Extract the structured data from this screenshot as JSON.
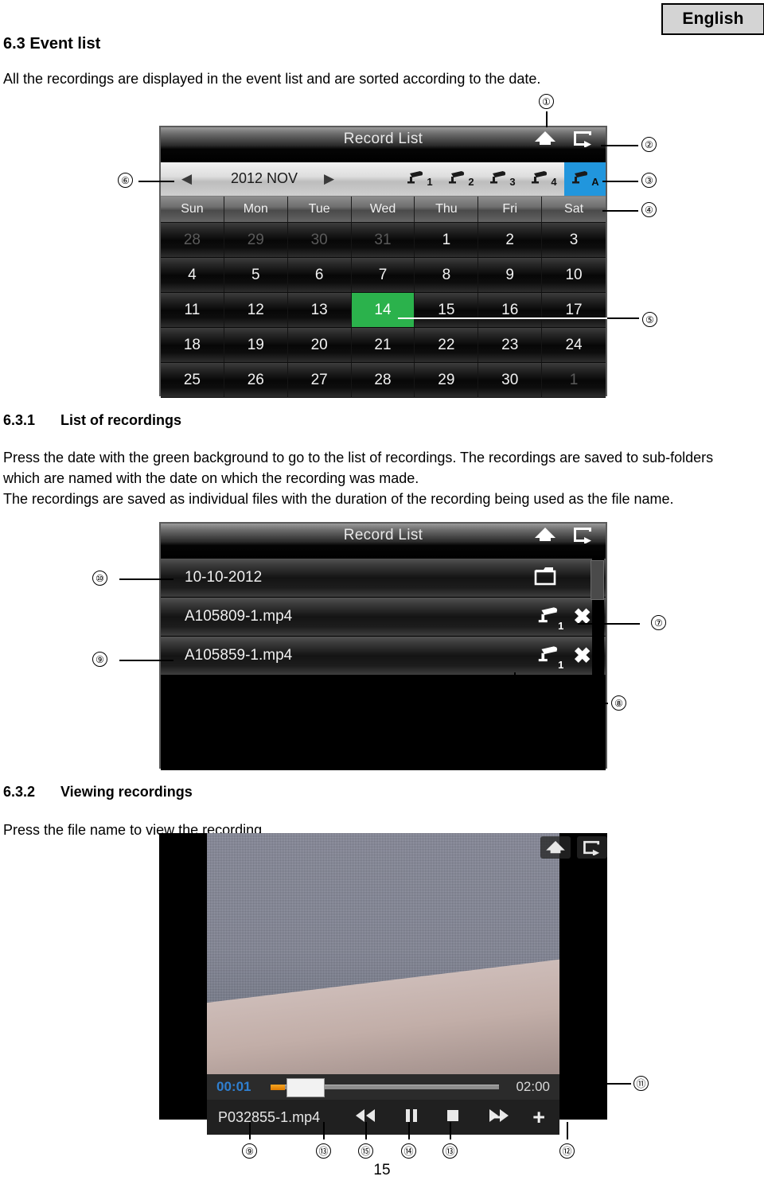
{
  "badge": {
    "language": "English"
  },
  "document": {
    "heading_1": "6.3 Event list",
    "intro": "All the recordings are displayed in the event list and are sorted according to the date.",
    "section_631_num": "6.3.1",
    "section_631_title": "List of recordings",
    "section_631_body": "Press the date with the green background to go to the list of recordings. The recordings are saved to sub-folders which are named with the date on which the recording was made.\nThe recordings are saved as individual files with the duration of the recording being used as the file name.",
    "section_632_num": "6.3.2",
    "section_632_title": "Viewing recordings",
    "section_632_body": "Press the file name to view the recording.",
    "page_number": "15"
  },
  "calendar_screen": {
    "title": "Record List",
    "icons": {
      "home": "home-icon",
      "exit": "exit-icon"
    },
    "prev_arrow": "◀",
    "next_arrow": "▶",
    "month_label": "2012 NOV",
    "camera_tabs": [
      {
        "label": "1",
        "active": false
      },
      {
        "label": "2",
        "active": false
      },
      {
        "label": "3",
        "active": false
      },
      {
        "label": "4",
        "active": false
      },
      {
        "label": "A",
        "active": true
      }
    ],
    "day_headers": [
      "Sun",
      "Mon",
      "Tue",
      "Wed",
      "Thu",
      "Fri",
      "Sat"
    ],
    "days": [
      {
        "n": "28",
        "muted": true
      },
      {
        "n": "29",
        "muted": true
      },
      {
        "n": "30",
        "muted": true
      },
      {
        "n": "31",
        "muted": true
      },
      {
        "n": "1"
      },
      {
        "n": "2"
      },
      {
        "n": "3"
      },
      {
        "n": "4"
      },
      {
        "n": "5"
      },
      {
        "n": "6"
      },
      {
        "n": "7"
      },
      {
        "n": "8"
      },
      {
        "n": "9"
      },
      {
        "n": "10"
      },
      {
        "n": "11"
      },
      {
        "n": "12"
      },
      {
        "n": "13"
      },
      {
        "n": "14",
        "today": true
      },
      {
        "n": "15"
      },
      {
        "n": "16"
      },
      {
        "n": "17"
      },
      {
        "n": "18"
      },
      {
        "n": "19"
      },
      {
        "n": "20"
      },
      {
        "n": "21"
      },
      {
        "n": "22"
      },
      {
        "n": "23"
      },
      {
        "n": "24"
      },
      {
        "n": "25"
      },
      {
        "n": "26"
      },
      {
        "n": "27"
      },
      {
        "n": "28"
      },
      {
        "n": "29"
      },
      {
        "n": "30"
      },
      {
        "n": "1",
        "muted": true
      }
    ],
    "highlight_color": "#2bb24c",
    "active_tab_color": "#2196dd"
  },
  "recordlist_screen": {
    "title": "Record List",
    "icons": {
      "home": "home-icon",
      "exit": "exit-icon"
    },
    "rows": [
      {
        "name": "10-10-2012",
        "type": "folder",
        "camera": "",
        "deletable": false
      },
      {
        "name": "A105809-1.mp4",
        "type": "file",
        "camera": "1",
        "deletable": true
      },
      {
        "name": "A105859-1.mp4",
        "type": "file",
        "camera": "1",
        "deletable": true
      }
    ],
    "delete_glyph": "✖"
  },
  "player_screen": {
    "icons": {
      "home": "home-icon",
      "exit": "exit-icon"
    },
    "time_current": "00:01",
    "time_total": "02:00",
    "file_name": "P032855-1.mp4",
    "controls": [
      "rewind",
      "pause",
      "stop",
      "fast-forward"
    ],
    "volume_down": "−",
    "volume_up": "+",
    "progress_percent": 1
  },
  "callouts": {
    "c1": "①",
    "c2": "②",
    "c3": "③",
    "c4": "④",
    "c5": "⑤",
    "c6": "⑥",
    "c7": "⑦",
    "c8": "⑧",
    "c9": "⑨",
    "c10": "⑩",
    "c11": "⑪",
    "c12": "⑫",
    "c13": "⑬",
    "c14": "⑭",
    "c15": "⑮"
  }
}
